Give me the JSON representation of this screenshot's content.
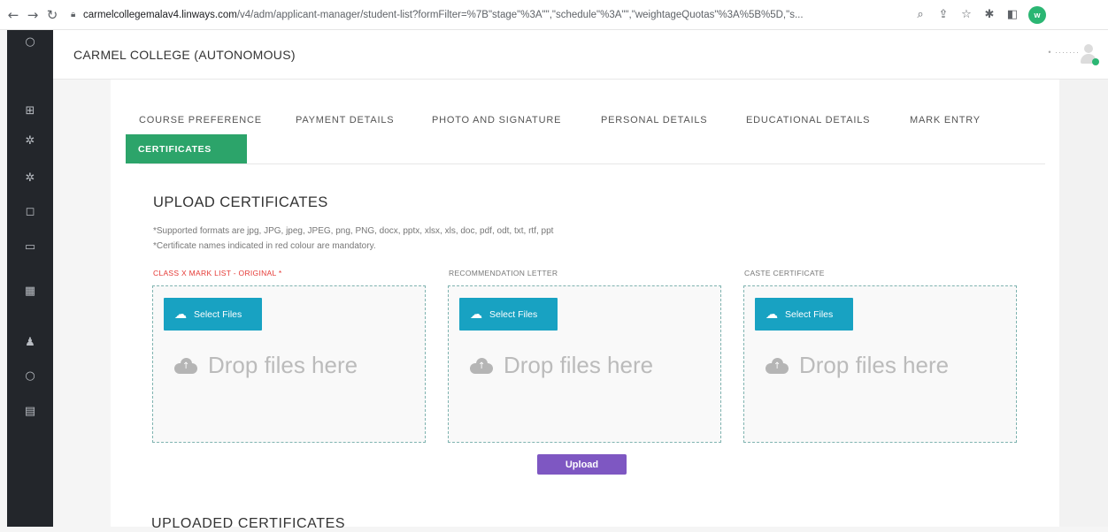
{
  "browser": {
    "url_host": "carmelcollegemalav4.linways.com",
    "url_path": "/v4/adm/applicant-manager/student-list?formFilter=%7B\"stage\"%3A\"\",\"schedule\"%3A\"\",\"weightageQuotas\"%3A%5B%5D,\"s...",
    "profile_initial": "w"
  },
  "header": {
    "college_name": "CARMEL COLLEGE (AUTONOMOUS)",
    "user_name": "• ·······"
  },
  "tabs": [
    {
      "label": "COURSE PREFERENCE"
    },
    {
      "label": "PAYMENT DETAILS"
    },
    {
      "label": "PHOTO AND SIGNATURE"
    },
    {
      "label": "PERSONAL DETAILS"
    },
    {
      "label": "EDUCATIONAL DETAILS"
    },
    {
      "label": "MARK ENTRY"
    }
  ],
  "active_tab": {
    "label": "CERTIFICATES"
  },
  "section": {
    "title": "UPLOAD CERTIFICATES",
    "note1": "*Supported formats are jpg, JPG, jpeg, JPEG, png, PNG, docx, pptx, xlsx, xls, doc, pdf, odt, txt, rtf, ppt",
    "note2": "*Certificate names indicated in red colour are mandatory."
  },
  "uploads": [
    {
      "label": "CLASS X MARK LIST - ORIGINAL *",
      "required": true,
      "button": "Select Files",
      "drop_text": "Drop files here"
    },
    {
      "label": "RECOMMENDATION LETTER",
      "required": false,
      "button": "Select Files",
      "drop_text": "Drop files here"
    },
    {
      "label": "CASTE CERTIFICATE",
      "required": false,
      "button": "Select Files",
      "drop_text": "Drop files here"
    }
  ],
  "upload_button": "Upload",
  "uploaded_title": "UPLOADED CERTIFICATES",
  "colors": {
    "sidebar": "#23262b",
    "active_tab": "#2ca46a",
    "select_button": "#18a2c2",
    "upload_button": "#7e57c2",
    "required": "#e53935"
  }
}
